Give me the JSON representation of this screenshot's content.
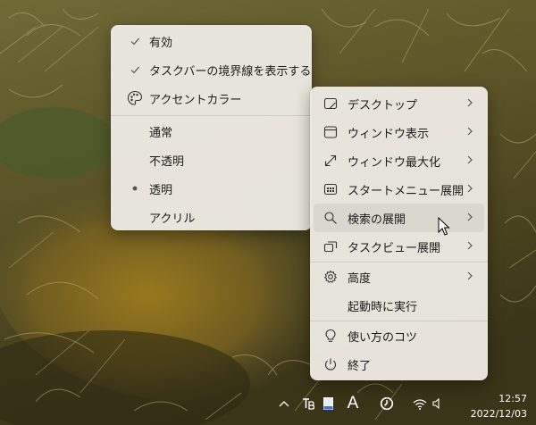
{
  "left_menu": {
    "items": [
      {
        "label": "有効",
        "lead": "check",
        "icon": "check-icon"
      },
      {
        "label": "タスクバーの境界線を表示する",
        "lead": "check",
        "icon": "check-icon"
      },
      {
        "label": "アクセントカラー",
        "lead": "palette",
        "icon": "palette-icon"
      }
    ],
    "options": [
      {
        "label": "通常",
        "selected": false
      },
      {
        "label": "不透明",
        "selected": false
      },
      {
        "label": "透明",
        "selected": true
      },
      {
        "label": "アクリル",
        "selected": false
      }
    ]
  },
  "right_menu": {
    "items": [
      {
        "label": "デスクトップ",
        "icon": "desktop-icon",
        "submenu": true
      },
      {
        "label": "ウィンドウ表示",
        "icon": "window-icon",
        "submenu": true
      },
      {
        "label": "ウィンドウ最大化",
        "icon": "maximize-icon",
        "submenu": true
      },
      {
        "label": "スタートメニュー展開",
        "icon": "start-menu-icon",
        "submenu": true
      },
      {
        "label": "検索の展開",
        "icon": "search-icon",
        "submenu": true,
        "hover": true
      },
      {
        "label": "タスクビュー展開",
        "icon": "task-view-icon",
        "submenu": true
      },
      {
        "label": "高度",
        "icon": "gear-icon",
        "submenu": true
      },
      {
        "label": "起動時に実行",
        "icon": "",
        "submenu": false
      },
      {
        "label": "使い方のコツ",
        "icon": "lightbulb-icon",
        "submenu": false
      },
      {
        "label": "終了",
        "icon": "power-icon",
        "submenu": false
      }
    ]
  },
  "taskbar": {
    "time": "12:57",
    "date": "2022/12/03",
    "font_icon_letter": "A"
  }
}
